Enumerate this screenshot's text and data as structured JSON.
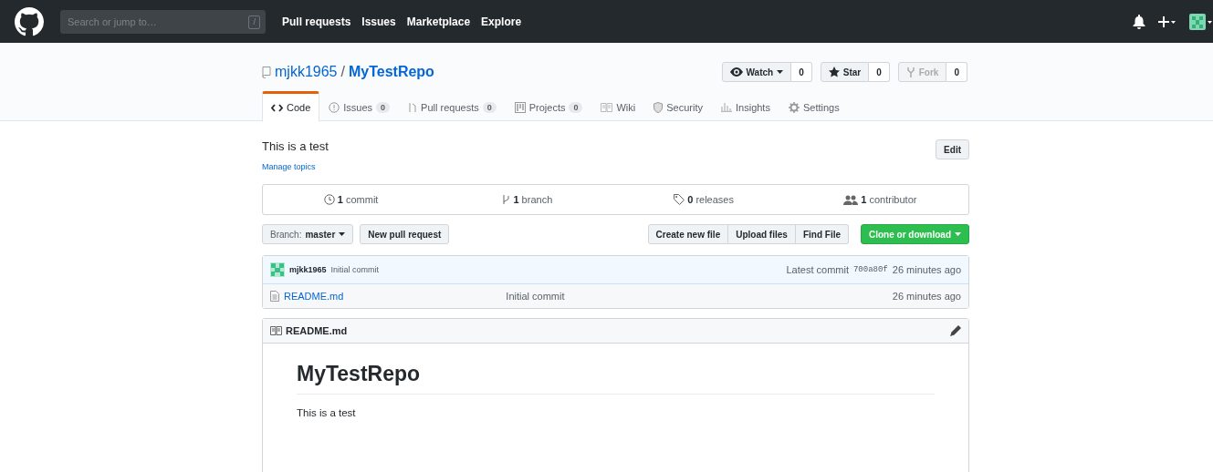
{
  "header": {
    "search": {
      "placeholder": "Search or jump to…",
      "key": "/"
    },
    "nav": [
      "Pull requests",
      "Issues",
      "Marketplace",
      "Explore"
    ]
  },
  "repo": {
    "owner": "mjkk1965",
    "separator": "/",
    "name": "MyTestRepo",
    "actions": [
      {
        "label": "Watch",
        "count": "0",
        "disabled": false,
        "kind": "watch"
      },
      {
        "label": "Star",
        "count": "0",
        "disabled": false,
        "kind": "star"
      },
      {
        "label": "Fork",
        "count": "0",
        "disabled": true,
        "kind": "fork"
      }
    ],
    "tabs": [
      {
        "label": "Code",
        "selected": true,
        "kind": "code"
      },
      {
        "label": "Issues",
        "counter": "0",
        "selected": false,
        "kind": "issues"
      },
      {
        "label": "Pull requests",
        "counter": "0",
        "selected": false,
        "kind": "pr"
      },
      {
        "label": "Projects",
        "counter": "0",
        "selected": false,
        "kind": "projects"
      },
      {
        "label": "Wiki",
        "selected": false,
        "kind": "wiki"
      },
      {
        "label": "Security",
        "selected": false,
        "kind": "security"
      },
      {
        "label": "Insights",
        "selected": false,
        "kind": "insights"
      },
      {
        "label": "Settings",
        "selected": false,
        "kind": "settings"
      }
    ]
  },
  "description": "This is a test",
  "edit_button": "Edit",
  "manage_topics": "Manage topics",
  "summary": [
    {
      "count": "1",
      "label": "commit",
      "kind": "commit"
    },
    {
      "count": "1",
      "label": "branch",
      "kind": "branch"
    },
    {
      "count": "0",
      "label": "releases",
      "kind": "tag"
    },
    {
      "count": "1",
      "label": "contributor",
      "kind": "people"
    }
  ],
  "branch": {
    "prefix": "Branch:",
    "name": "master"
  },
  "new_pr": "New pull request",
  "file_buttons": [
    "Create new file",
    "Upload files",
    "Find File"
  ],
  "clone": "Clone or download",
  "commit": {
    "author": "mjkk1965",
    "message": "Initial commit",
    "latest": "Latest commit",
    "sha": "700a80f",
    "time": "26 minutes ago"
  },
  "files": [
    {
      "name": "README.md",
      "message": "Initial commit",
      "time": "26 minutes ago"
    }
  ],
  "readme": {
    "title": "README.md",
    "heading": "MyTestRepo",
    "body": "This is a test"
  }
}
